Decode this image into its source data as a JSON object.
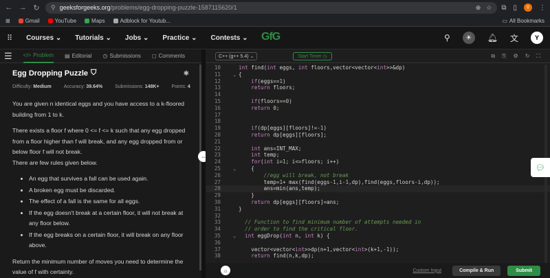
{
  "browser": {
    "url_host": "geeksforgeeks.org",
    "url_path": "/problems/egg-dropping-puzzle-1587115620/1",
    "profile_initial": "Y"
  },
  "bookmarks": {
    "items": [
      "Gmail",
      "YouTube",
      "Maps",
      "Adblock for Youtub..."
    ],
    "all_label": "All Bookmarks"
  },
  "site": {
    "menus": [
      "Courses",
      "Tutorials",
      "Jobs",
      "Practice",
      "Contests"
    ],
    "logo": "GfG",
    "avatar": "Y"
  },
  "tabs": [
    "Problem",
    "Editorial",
    "Submissions",
    "Comments"
  ],
  "problem": {
    "title": "Egg Dropping Puzzle",
    "difficulty_label": "Difficulty:",
    "difficulty": "Medium",
    "accuracy_label": "Accuracy:",
    "accuracy": "39.64%",
    "submissions_label": "Submissions:",
    "submissions": "148K+",
    "points_label": "Points:",
    "points": "4",
    "p1": "You are given n identical eggs and you have access to a k-floored building from 1 to k.",
    "p2": "There exists a floor f where 0 <= f <= k such that any egg dropped from a floor higher than f will break, and any egg dropped from or below floor f will not break.",
    "p3": "There are  few rules given below.",
    "rules": [
      "An egg that survives a fall can be used again.",
      "A broken egg must be discarded.",
      "The effect of a fall is the same for all eggs.",
      "If the egg doesn't break at a certain floor, it will not break at any floor below.",
      "If the egg breaks on a certain floor, it will break on any floor above."
    ],
    "p4": "Return the minimum number of moves you need to determine the value of f with certainty."
  },
  "editor": {
    "language": "C++ (g++ 5.4)",
    "timer": "Start Timer",
    "custom_input": "Custom Input",
    "compile_run": "Compile & Run",
    "submit": "Submit"
  },
  "code_lines": [
    {
      "n": "10",
      "text": "int find(int eggs, int floors,vector<vector<int>>&dp)"
    },
    {
      "n": "11",
      "text": "{",
      "fold": "v"
    },
    {
      "n": "12",
      "text": "    if(eggs==1)"
    },
    {
      "n": "13",
      "text": "    return floors;"
    },
    {
      "n": "14",
      "text": ""
    },
    {
      "n": "15",
      "text": "    if(floors==0)"
    },
    {
      "n": "16",
      "text": "    return 0;"
    },
    {
      "n": "17",
      "text": ""
    },
    {
      "n": "18",
      "text": ""
    },
    {
      "n": "19",
      "text": "    if(dp[eggs][floors]!=-1)"
    },
    {
      "n": "20",
      "text": "    return dp[eggs][floors];"
    },
    {
      "n": "21",
      "text": ""
    },
    {
      "n": "22",
      "text": "    int ans=INT_MAX;"
    },
    {
      "n": "23",
      "text": "    int temp;"
    },
    {
      "n": "24",
      "text": "    for(int i=1; i<=floors; i++)"
    },
    {
      "n": "25",
      "text": "    {",
      "fold": "v"
    },
    {
      "n": "26",
      "text": "        //egg will break, not break",
      "comment": true
    },
    {
      "n": "27",
      "text": "        temp=1+ max(find(eggs-1,i-1,dp),find(eggs,floors-i,dp));"
    },
    {
      "n": "28",
      "text": "        ans=min(ans,temp);",
      "hl": true
    },
    {
      "n": "29",
      "text": "    }"
    },
    {
      "n": "30",
      "text": "    return dp[eggs][floors]=ans;"
    },
    {
      "n": "31",
      "text": "}"
    },
    {
      "n": "32",
      "text": ""
    },
    {
      "n": "33",
      "text": "  // Function to find minimum number of attempts needed in",
      "comment": true
    },
    {
      "n": "34",
      "text": "  // order to find the critical floor.",
      "comment": true
    },
    {
      "n": "35",
      "text": "  int eggDrop(int n, int k) {",
      "fold": "v"
    },
    {
      "n": "36",
      "text": ""
    },
    {
      "n": "37",
      "text": "    vector<vector<int>>dp(n+1,vector<int>(k+1,-1));"
    },
    {
      "n": "38",
      "text": "    return find(n,k,dp);"
    }
  ]
}
